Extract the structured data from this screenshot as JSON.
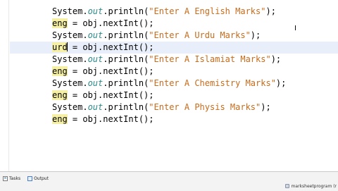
{
  "editor": {
    "current_line": 3,
    "lines": [
      {
        "type": "print",
        "prefix": "System.",
        "out": "out",
        "mid": ".println(",
        "string": "\"Enter A English Marks\"",
        "suffix": ");"
      },
      {
        "type": "assign",
        "var": "eng",
        "rest": " = obj.nextInt();"
      },
      {
        "type": "print",
        "prefix": "System.",
        "out": "out",
        "mid": ".println(",
        "string": "\"Enter A Urdu Marks\"",
        "suffix": ");"
      },
      {
        "type": "assign",
        "var": "urd",
        "rest": " = obj.nextInt();"
      },
      {
        "type": "print",
        "prefix": "System.",
        "out": "out",
        "mid": ".println(",
        "string": "\"Enter A Islamiat Marks\"",
        "suffix": ");"
      },
      {
        "type": "assign",
        "var": "eng",
        "rest": " = obj.nextInt();"
      },
      {
        "type": "print",
        "prefix": "System.",
        "out": "out",
        "mid": ".println(",
        "string": "\"Enter A Chemistry Marks\"",
        "suffix": ");"
      },
      {
        "type": "assign",
        "var": "eng",
        "rest": " = obj.nextInt();"
      },
      {
        "type": "print",
        "prefix": "System.",
        "out": "out",
        "mid": ".println(",
        "string": "\"Enter A Physis Marks\"",
        "suffix": ");"
      },
      {
        "type": "assign",
        "var": "eng",
        "rest": " = obj.nextInt();"
      }
    ]
  },
  "bottom_tabs": [
    {
      "label": "Tasks",
      "icon": "tasks-icon"
    },
    {
      "label": "Output",
      "icon": "output-icon"
    }
  ],
  "status": {
    "text": "marksheetprogram (r"
  },
  "colors": {
    "out_keyword": "#2e8b8b",
    "string": "#c86b1a",
    "variable_highlight": "#f5f0a6",
    "current_line": "#e9effa"
  }
}
